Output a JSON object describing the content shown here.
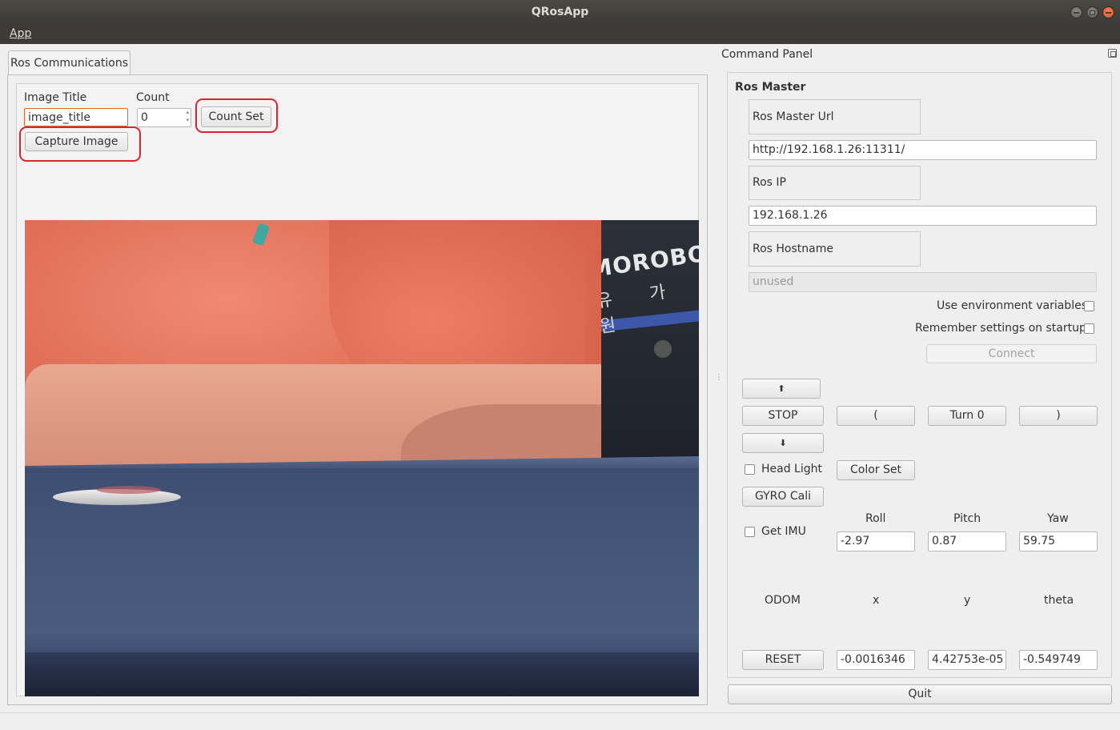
{
  "window": {
    "title": "QRosApp"
  },
  "menu": {
    "app_label": "App"
  },
  "tabs": {
    "active_label": "Ros Communications"
  },
  "capture": {
    "image_title_label": "Image Title",
    "image_title_value": "image_title",
    "count_label": "Count",
    "count_value": "0",
    "count_set_label": "Count Set",
    "capture_image_label": "Capture Image"
  },
  "camera_feed": {
    "logo_text": "MOROBO",
    "hangul_text": "유 가 원"
  },
  "command_panel": {
    "title": "Command Panel",
    "ros_master": {
      "group_title": "Ros Master",
      "master_url_label": "Ros Master Url",
      "master_url_value": "http://192.168.1.26:11311/",
      "ros_ip_label": "Ros IP",
      "ros_ip_value": "192.168.1.26",
      "hostname_label": "Ros Hostname",
      "hostname_placeholder": "unused",
      "use_env_label": "Use environment variables",
      "remember_label": "Remember settings on startup",
      "connect_label": "Connect"
    },
    "drive": {
      "forward_label": "⬆",
      "stop_label": "STOP",
      "left_label": "(",
      "turn_label": "Turn 0",
      "right_label": ")",
      "backward_label": "⬇"
    },
    "head_light_label": "Head Light",
    "color_set_label": "Color Set",
    "gyro_cali_label": "GYRO Cali",
    "imu": {
      "get_imu_label": "Get IMU",
      "roll_label": "Roll",
      "pitch_label": "Pitch",
      "yaw_label": "Yaw",
      "roll_value": "-2.97",
      "pitch_value": "0.87",
      "yaw_value": "59.75"
    },
    "odom": {
      "odom_label": "ODOM",
      "x_label": "x",
      "y_label": "y",
      "theta_label": "theta",
      "reset_label": "RESET",
      "x_value": "-0.0016346",
      "y_value": "4.42753e-05",
      "theta_value": "-0.549749"
    },
    "quit_label": "Quit"
  },
  "colors": {
    "titlebar": "#3c3b37",
    "highlight": "#d7262f",
    "input_focus_border": "#e8672c"
  }
}
